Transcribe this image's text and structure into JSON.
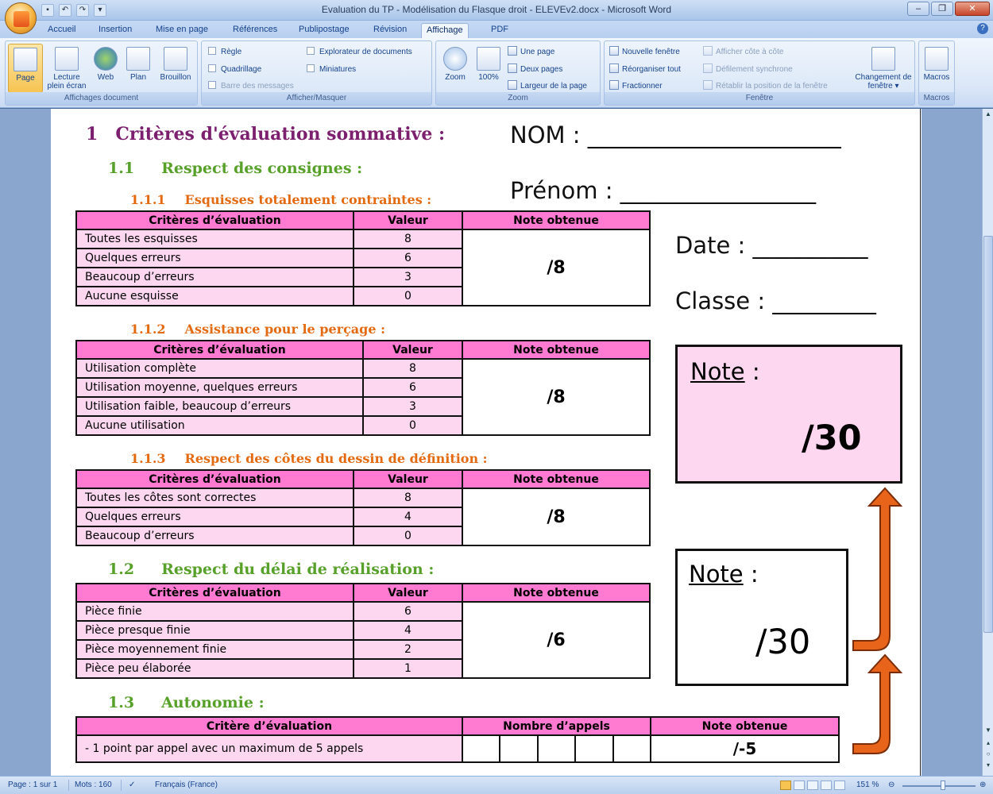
{
  "window": {
    "title": "Evaluation du TP - Modélisation du Flasque droit - ELEVEv2.docx - Microsoft Word",
    "minimize_label": "‒",
    "restore_label": "❐",
    "close_label": "✕"
  },
  "tabs": [
    "Accueil",
    "Insertion",
    "Mise en page",
    "Références",
    "Publipostage",
    "Révision",
    "Affichage",
    "PDF"
  ],
  "active_tab": "Affichage",
  "ribbon": {
    "affichages": {
      "label": "Affichages document",
      "buttons": [
        "Page",
        "Lecture plein écran",
        "Web",
        "Plan",
        "Brouillon"
      ]
    },
    "afficher": {
      "label": "Afficher/Masquer",
      "items": [
        "Règle",
        "Quadrillage",
        "Barre des messages",
        "Explorateur de documents",
        "Miniatures"
      ]
    },
    "zoom": {
      "label": "Zoom",
      "zoom_btn": "Zoom",
      "percent_btn": "100%",
      "items": [
        "Une page",
        "Deux pages",
        "Largeur de la page"
      ]
    },
    "fenetre": {
      "label": "Fenêtre",
      "items": [
        "Nouvelle fenêtre",
        "Réorganiser tout",
        "Fractionner"
      ],
      "disabled_items": [
        "Afficher côte à côte",
        "Défilement synchrone",
        "Rétablir la position de la fenêtre"
      ],
      "switch_btn": "Changement de fenêtre ▾"
    },
    "macros": {
      "label": "Macros",
      "btn": "Macros"
    }
  },
  "document": {
    "h1": {
      "num": "1",
      "text": "Critères d'évaluation sommative :"
    },
    "h1_1": {
      "num": "1.1",
      "text": "Respect des consignes :"
    },
    "h1_1_1": {
      "num": "1.1.1",
      "text": "Esquisses totalement contraintes :"
    },
    "h1_1_2": {
      "num": "1.1.2",
      "text": "Assistance pour le perçage :"
    },
    "h1_1_3": {
      "num": "1.1.3",
      "text": "Respect des côtes du dessin de définition :"
    },
    "h1_2": {
      "num": "1.2",
      "text": "Respect du délai de réalisation :"
    },
    "h1_3": {
      "num": "1.3",
      "text": "Autonomie :"
    },
    "fields": {
      "nom": "NOM : ______________________",
      "prenom": "Prénom : _________________",
      "date": "Date : __________",
      "classe": "Classe : _________"
    },
    "col_headers": {
      "crit": "Critères d’évaluation",
      "val": "Valeur",
      "note": "Note obtenue"
    },
    "table1": {
      "rows": [
        [
          "Toutes les esquisses",
          "8"
        ],
        [
          "Quelques erreurs",
          "6"
        ],
        [
          "Beaucoup d’erreurs",
          "3"
        ],
        [
          "Aucune esquisse",
          "0"
        ]
      ],
      "note": "/8"
    },
    "table2": {
      "rows": [
        [
          "Utilisation complète",
          "8"
        ],
        [
          "Utilisation moyenne, quelques  erreurs",
          "6"
        ],
        [
          "Utilisation faible, beaucoup d’erreurs",
          "3"
        ],
        [
          "Aucune utilisation",
          "0"
        ]
      ],
      "note": "/8"
    },
    "table3": {
      "rows": [
        [
          "Toutes les côtes sont correctes",
          "8"
        ],
        [
          "Quelques erreurs",
          "4"
        ],
        [
          "Beaucoup d’erreurs",
          "0"
        ]
      ],
      "note": "/8"
    },
    "table4": {
      "rows": [
        [
          "Pièce finie",
          "6"
        ],
        [
          "Pièce presque finie",
          "4"
        ],
        [
          "Pièce moyennement finie",
          "2"
        ],
        [
          "Pièce peu élaborée",
          "1"
        ]
      ],
      "note": "/6"
    },
    "table5": {
      "headers": [
        "Critère d’évaluation",
        "Nombre d’appels",
        "Note obtenue"
      ],
      "row": "- 1 point par appel avec un maximum de 5 appels",
      "note": "/-5"
    },
    "note_box_1": {
      "label": "Note",
      "colon": " :",
      "value": "/30"
    },
    "note_box_2": {
      "label": "Note",
      "colon": " :",
      "value": "/30"
    },
    "colors": {
      "h1": "#7b1f6e",
      "h2": "#57a02a",
      "h3": "#e46a12",
      "table_header": "#ff7ad0",
      "table_cell": "#fdd7f0",
      "arrow": "#e8641a"
    }
  },
  "status": {
    "page": "Page : 1 sur 1",
    "words": "Mots : 160",
    "lang": "Français (France)",
    "zoom": "151 %"
  }
}
